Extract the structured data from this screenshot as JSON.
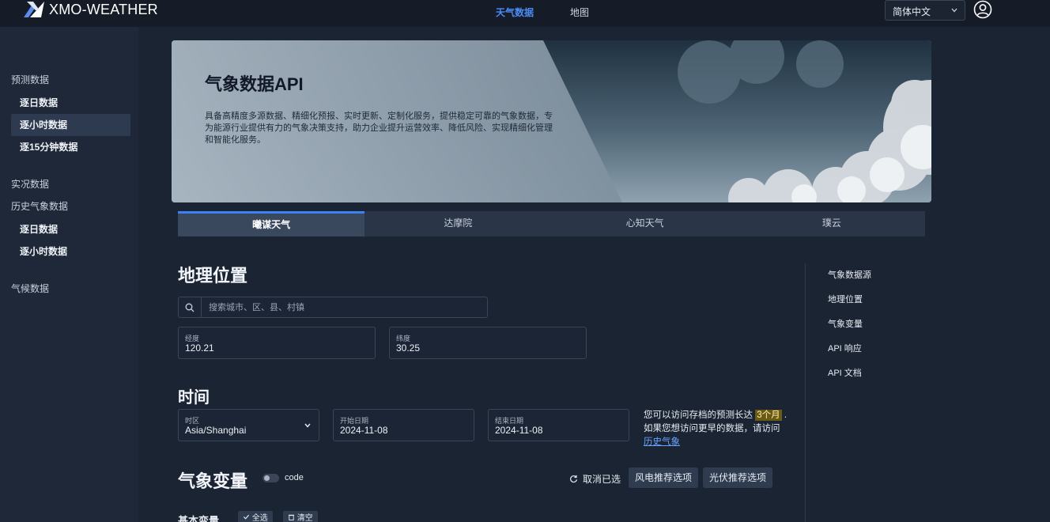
{
  "topbar": {
    "brand": "XMO-WEATHER",
    "nav": {
      "weather": "天气数据",
      "map": "地图"
    },
    "language": "简体中文"
  },
  "sidebar": {
    "forecast_group": "预测数据",
    "forecast_items": [
      "逐日数据",
      "逐小时数据",
      "逐15分钟数据"
    ],
    "realtime_group": "实况数据",
    "history_group": "历史气象数据",
    "history_items": [
      "逐日数据",
      "逐小时数据"
    ],
    "climate_group": "气候数据"
  },
  "banner": {
    "title": "气象数据API",
    "description": "具备高精度多源数据、精细化预报、实时更新、定制化服务，提供稳定可靠的气象数据，专为能源行业提供有力的气象决策支持，助力企业提升运营效率、降低风险、实现精细化管理和智能化服务。"
  },
  "providers": [
    "曦谋天气",
    "达摩院",
    "心知天气",
    "璞云"
  ],
  "location": {
    "heading": "地理位置",
    "search_placeholder": "搜索城市、区、县、村镇",
    "longitude_label": "经度",
    "longitude_value": "120.21",
    "latitude_label": "纬度",
    "latitude_value": "30.25"
  },
  "time": {
    "heading": "时间",
    "timezone_label": "时区",
    "timezone_value": "Asia/Shanghai",
    "start_label": "开始日期",
    "start_value": "2024-11-08",
    "end_label": "结束日期",
    "end_value": "2024-11-08",
    "note_prefix": "您可以访问存档的预测长达",
    "note_highlight": "3个月",
    "note_suffix": ".",
    "note_line2": "如果您想访问更早的数据，请访问",
    "note_link": "历史气象"
  },
  "variables": {
    "heading": "气象变量",
    "toggle_label": "code",
    "clear_selected": "取消已选",
    "wind_recommend": "风电推荐选项",
    "solar_recommend": "光伏推荐选项",
    "basic_label": "基本变量",
    "select_all": "全选",
    "clear": "清空"
  },
  "anchors": [
    "气象数据源",
    "地理位置",
    "气象变量",
    "API 响应",
    "API 文档"
  ],
  "colors": {
    "accent": "#3b82f6",
    "highlight": "#6b5a14",
    "link": "#6aa3ff"
  },
  "icons": [
    "brand-logo-icon",
    "chevron-down-icon",
    "user-avatar-icon",
    "search-icon",
    "refresh-icon",
    "check-icon",
    "trash-icon"
  ]
}
